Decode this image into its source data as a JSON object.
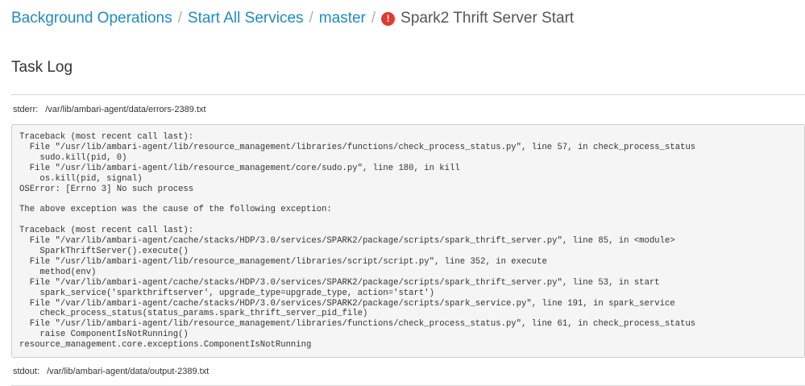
{
  "breadcrumb": {
    "items": [
      "Background Operations",
      "Start All Services",
      "master"
    ],
    "separator": "/",
    "current": "Spark2 Thrift Server Start",
    "status_icon": "error-icon",
    "status_glyph": "!",
    "status_color": "#e03a34",
    "link_color": "#1e8bc3"
  },
  "section": {
    "title": "Task Log"
  },
  "stderr": {
    "label": "stderr:",
    "path": "/var/lib/ambari-agent/data/errors-2389.txt"
  },
  "log": {
    "text": "Traceback (most recent call last):\n  File \"/usr/lib/ambari-agent/lib/resource_management/libraries/functions/check_process_status.py\", line 57, in check_process_status\n    sudo.kill(pid, 0)\n  File \"/usr/lib/ambari-agent/lib/resource_management/core/sudo.py\", line 180, in kill\n    os.kill(pid, signal)\nOSError: [Errno 3] No such process\n\nThe above exception was the cause of the following exception:\n\nTraceback (most recent call last):\n  File \"/var/lib/ambari-agent/cache/stacks/HDP/3.0/services/SPARK2/package/scripts/spark_thrift_server.py\", line 85, in <module>\n    SparkThriftServer().execute()\n  File \"/usr/lib/ambari-agent/lib/resource_management/libraries/script/script.py\", line 352, in execute\n    method(env)\n  File \"/var/lib/ambari-agent/cache/stacks/HDP/3.0/services/SPARK2/package/scripts/spark_thrift_server.py\", line 53, in start\n    spark_service('sparkthriftserver', upgrade_type=upgrade_type, action='start')\n  File \"/var/lib/ambari-agent/cache/stacks/HDP/3.0/services/SPARK2/package/scripts/spark_service.py\", line 191, in spark_service\n    check_process_status(status_params.spark_thrift_server_pid_file)\n  File \"/usr/lib/ambari-agent/lib/resource_management/libraries/functions/check_process_status.py\", line 61, in check_process_status\n    raise ComponentIsNotRunning()\nresource_management.core.exceptions.ComponentIsNotRunning"
  },
  "stdout": {
    "label": "stdout:",
    "path": "/var/lib/ambari-agent/data/output-2389.txt"
  }
}
